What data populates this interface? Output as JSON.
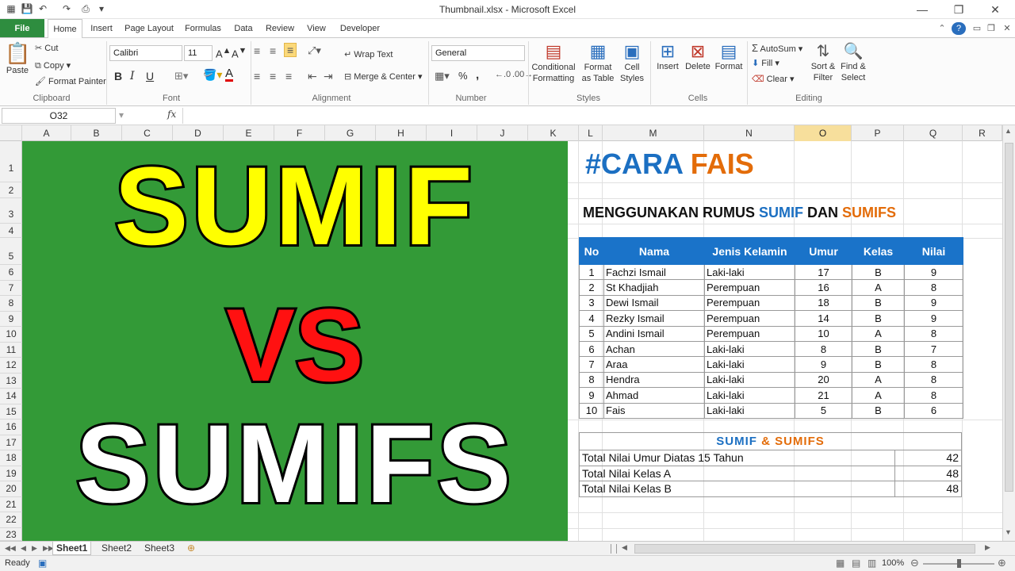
{
  "window": {
    "title": "Thumbnail.xlsx - Microsoft Excel",
    "minimize": "—",
    "restore": "❐",
    "close": "✕"
  },
  "tabs": [
    "File",
    "Home",
    "Insert",
    "Page Layout",
    "Formulas",
    "Data",
    "Review",
    "View",
    "Developer"
  ],
  "ribbon": {
    "clipboard": {
      "paste": "Paste",
      "cut": "Cut",
      "copy": "Copy",
      "format_painter": "Format Painter",
      "label": "Clipboard"
    },
    "font": {
      "name": "Calibri",
      "size": "11",
      "bold": "B",
      "italic": "I",
      "underline": "U",
      "label": "Font"
    },
    "alignment": {
      "wrap": "Wrap Text",
      "merge": "Merge & Center",
      "label": "Alignment"
    },
    "number": {
      "format": "General",
      "currency": "$",
      "percent": "%",
      "comma": ",",
      "label": "Number"
    },
    "styles": {
      "conditional": "Conditional Formatting",
      "format_table": "Format as Table",
      "cell_styles": "Cell Styles",
      "label": "Styles"
    },
    "cells": {
      "insert": "Insert",
      "delete": "Delete",
      "format": "Format",
      "label": "Cells"
    },
    "editing": {
      "autosum": "AutoSum",
      "fill": "Fill",
      "clear": "Clear",
      "sort": "Sort & Filter",
      "find": "Find & Select",
      "label": "Editing"
    }
  },
  "formula_bar": {
    "name_box": "O32",
    "fx": "fx",
    "value": ""
  },
  "columns": [
    "A",
    "B",
    "C",
    "D",
    "E",
    "F",
    "G",
    "H",
    "I",
    "J",
    "K",
    "L",
    "M",
    "N",
    "O",
    "P",
    "Q",
    "R"
  ],
  "active_column": "O",
  "rows": [
    "1",
    "2",
    "3",
    "4",
    "5",
    "6",
    "7",
    "8",
    "9",
    "10",
    "11",
    "12",
    "13",
    "14",
    "15",
    "16",
    "17",
    "18",
    "19",
    "20",
    "21",
    "22",
    "23"
  ],
  "banner": {
    "line1": "SUMIF",
    "line2": "VS",
    "line3": "SUMIFS",
    "bg": "#339a37"
  },
  "brand": {
    "hash_cara": "#CARA",
    "fais": "FAIS"
  },
  "heading": {
    "prefix": "MENGGUNAKAN RUMUS",
    "sumif": "SUMIF",
    "dan": "DAN",
    "sumifs": "SUMIFS"
  },
  "table": {
    "headers": [
      "No",
      "Nama",
      "Jenis Kelamin",
      "Umur",
      "Kelas",
      "Nilai"
    ],
    "rows": [
      [
        "1",
        "Fachzi Ismail",
        "Laki-laki",
        "17",
        "B",
        "9"
      ],
      [
        "2",
        "St Khadjiah",
        "Perempuan",
        "16",
        "A",
        "8"
      ],
      [
        "3",
        "Dewi Ismail",
        "Perempuan",
        "18",
        "B",
        "9"
      ],
      [
        "4",
        "Rezky Ismail",
        "Perempuan",
        "14",
        "B",
        "9"
      ],
      [
        "5",
        "Andini Ismail",
        "Perempuan",
        "10",
        "A",
        "8"
      ],
      [
        "6",
        "Achan",
        "Laki-laki",
        "8",
        "B",
        "7"
      ],
      [
        "7",
        "Araa",
        "Laki-laki",
        "9",
        "B",
        "8"
      ],
      [
        "8",
        "Hendra",
        "Laki-laki",
        "20",
        "A",
        "8"
      ],
      [
        "9",
        "Ahmad",
        "Laki-laki",
        "21",
        "A",
        "8"
      ],
      [
        "10",
        "Fais",
        "Laki-laki",
        "5",
        "B",
        "6"
      ]
    ]
  },
  "summary": {
    "title_a": "SUMIF",
    "title_amp": "&",
    "title_b": "SUMIFS",
    "rows": [
      [
        "Total Nilai Umur Diatas 15 Tahun",
        "42"
      ],
      [
        "Total Nilai Kelas A",
        "48"
      ],
      [
        "Total Nilai Kelas B",
        "48"
      ]
    ]
  },
  "sheets": [
    "Sheet1",
    "Sheet2",
    "Sheet3"
  ],
  "active_sheet": "Sheet1",
  "status": {
    "ready": "Ready",
    "zoom": "100%"
  }
}
